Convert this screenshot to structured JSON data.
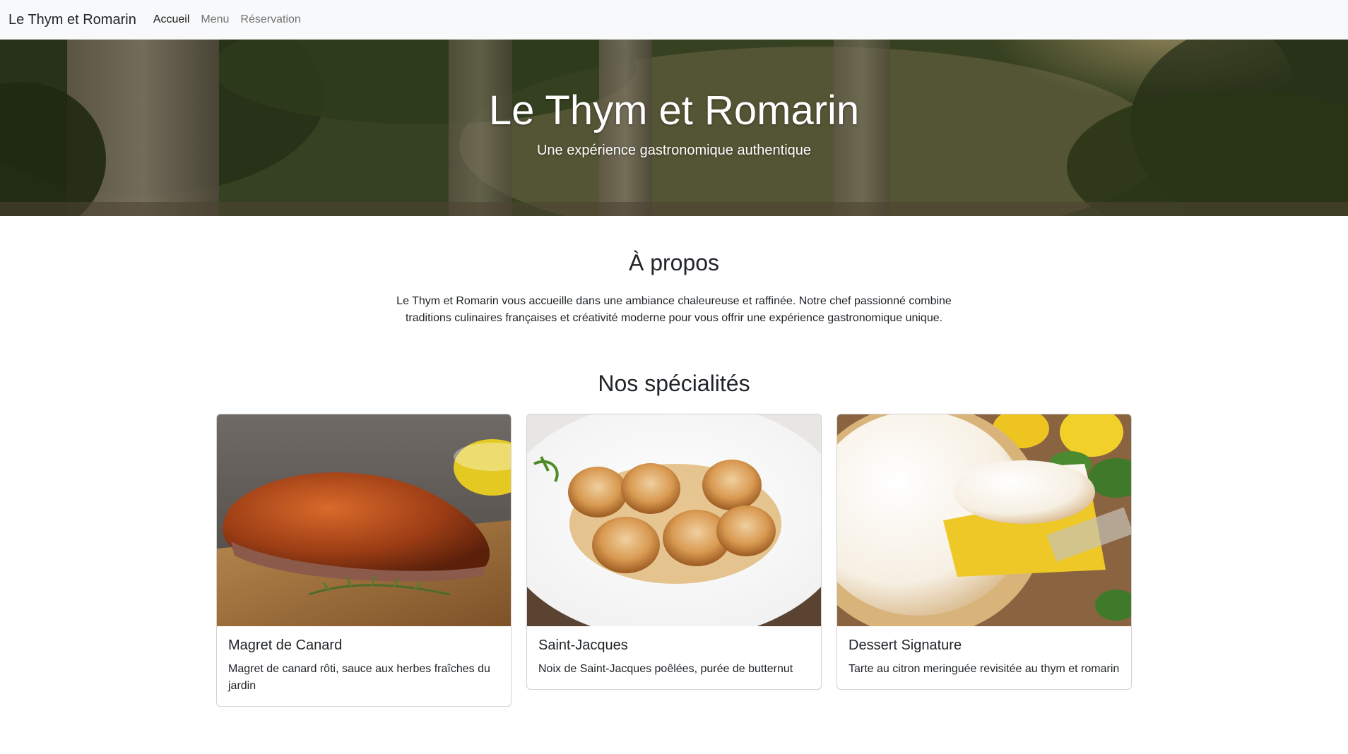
{
  "navbar": {
    "brand": "Le Thym et Romarin",
    "links": [
      {
        "label": "Accueil",
        "active": true
      },
      {
        "label": "Menu",
        "active": false
      },
      {
        "label": "Réservation",
        "active": false
      }
    ]
  },
  "hero": {
    "title": "Le Thym et Romarin",
    "subtitle": "Une expérience gastronomique authentique"
  },
  "about": {
    "title": "À propos",
    "text": "Le Thym et Romarin vous accueille dans une ambiance chaleureuse et raffinée. Notre chef passionné combine traditions culinaires françaises et créativité moderne pour vous offrir une expérience gastronomique unique."
  },
  "specialties": {
    "title": "Nos spécialités",
    "cards": [
      {
        "title": "Magret de Canard",
        "text": "Magret de canard rôti, sauce aux herbes fraîches du jardin",
        "image": "duck-breast-photo"
      },
      {
        "title": "Saint-Jacques",
        "text": "Noix de Saint-Jacques poêlées, purée de butternut",
        "image": "scallops-photo"
      },
      {
        "title": "Dessert Signature",
        "text": "Tarte au citron meringuée revisitée au thym et romarin",
        "image": "lemon-meringue-tart-photo"
      }
    ]
  }
}
